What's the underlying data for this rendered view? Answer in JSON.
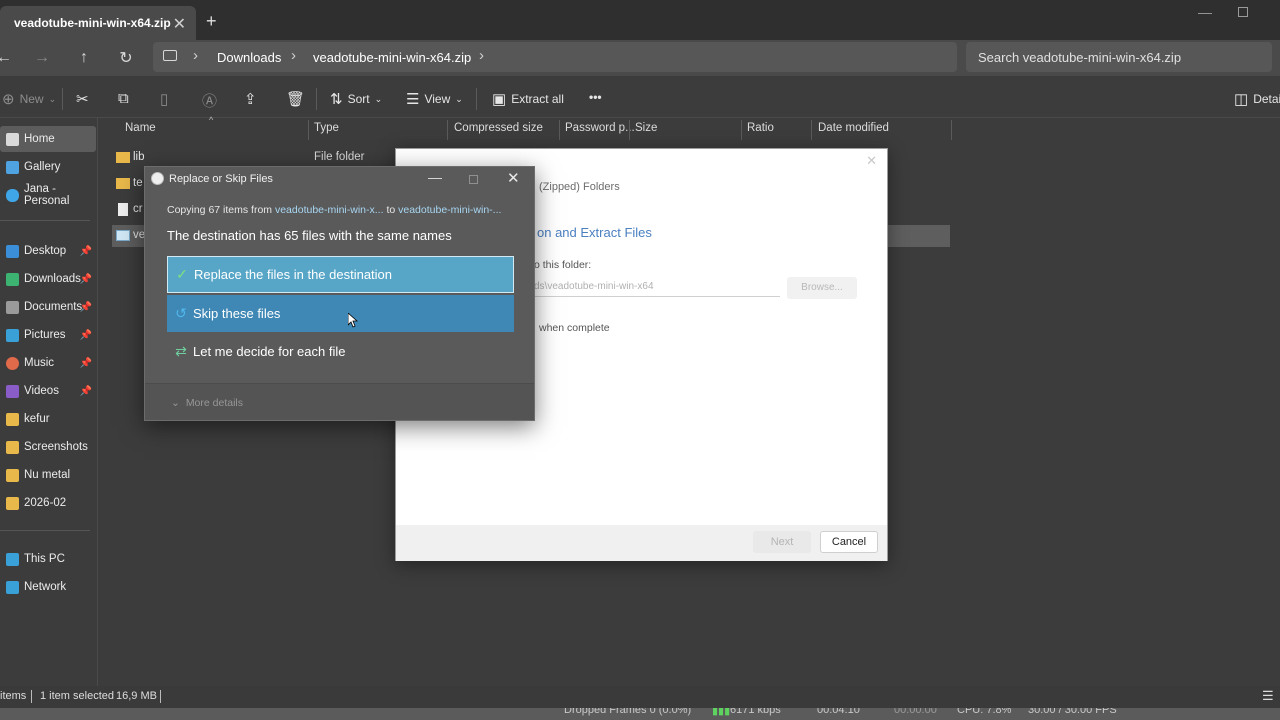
{
  "tab": {
    "title": "veadotube-mini-win-x64.zip",
    "close": "✕",
    "new": "+"
  },
  "window": {
    "minimize": "—"
  },
  "nav": {
    "back": "←",
    "forward": "→",
    "up": "↑",
    "refresh": "↻"
  },
  "breadcrumb": {
    "items": [
      "Downloads",
      "veadotube-mini-win-x64.zip"
    ],
    "sep": "›"
  },
  "search": {
    "placeholder": "Search veadotube-mini-win-x64.zip"
  },
  "commands": {
    "new": "New",
    "sort": "Sort",
    "view": "View",
    "extract_all": "Extract all",
    "more": "•••",
    "details": "Detai"
  },
  "sidebar": {
    "items": [
      {
        "label": "Home",
        "icon": "home-icon",
        "color": "#d9d9d9"
      },
      {
        "label": "Gallery",
        "icon": "gallery-icon",
        "color": "#4fa3e0"
      },
      {
        "label": "Jana - Personal",
        "icon": "cloud-icon",
        "color": "#3fa6e8"
      },
      {
        "label": "Desktop",
        "icon": "desktop-icon",
        "color": "#3b8fd8"
      },
      {
        "label": "Downloads",
        "icon": "download-icon",
        "color": "#3cb371"
      },
      {
        "label": "Documents",
        "icon": "documents-icon",
        "color": "#9a9a9a"
      },
      {
        "label": "Pictures",
        "icon": "pictures-icon",
        "color": "#3aa0d8"
      },
      {
        "label": "Music",
        "icon": "music-icon",
        "color": "#e06a4a"
      },
      {
        "label": "Videos",
        "icon": "videos-icon",
        "color": "#8a5cc8"
      },
      {
        "label": "kefur",
        "icon": "folder-icon",
        "color": "#e8b84a"
      },
      {
        "label": "Screenshots",
        "icon": "folder-icon",
        "color": "#e8b84a"
      },
      {
        "label": "Nu metal",
        "icon": "folder-icon",
        "color": "#e8b84a"
      },
      {
        "label": "2026-02",
        "icon": "folder-icon",
        "color": "#e8b84a"
      },
      {
        "label": "This PC",
        "icon": "pc-icon",
        "color": "#3aa0d8"
      },
      {
        "label": "Network",
        "icon": "network-icon",
        "color": "#3aa0d8"
      }
    ]
  },
  "columns": [
    "Name",
    "Type",
    "Compressed size",
    "Password p...",
    "Size",
    "Ratio",
    "Date modified"
  ],
  "files": [
    {
      "name": "lib",
      "type": "File folder",
      "icon": "folder-icon"
    },
    {
      "name": "te",
      "type": "",
      "icon": "folder-icon"
    },
    {
      "name": "cr",
      "type": "",
      "icon": "file-icon"
    },
    {
      "name": "ve",
      "type": "",
      "icon": "app-icon"
    }
  ],
  "status": {
    "items": "items",
    "selected": "1 item selected",
    "size": "16,9 MB"
  },
  "taskbar": {
    "dropped": "Dropped Frames 0 (0.0%)",
    "kbps": "6171 kbps",
    "time1": "00:04:10",
    "time2": "00:00:00",
    "cpu": "CPU: 7.8%",
    "fps": "30.00 / 30.00 FPS"
  },
  "wizard": {
    "subtitle": "(Zipped) Folders",
    "heading": "on and Extract Files",
    "label": "o this folder:",
    "path": "ds\\veadotube-mini-win-x64",
    "browse": "Browse...",
    "check": "when complete",
    "next": "Next",
    "cancel": "Cancel",
    "close": "✕"
  },
  "dialog": {
    "title": "Replace or Skip Files",
    "copying_prefix": "Copying 67 items from",
    "source": "veadotube-mini-win-x...",
    "to": "to",
    "dest": "veadotube-mini-win-...",
    "heading": "The destination has 65 files with the same names",
    "replace": "Replace the files in the destination",
    "skip": "Skip these files",
    "decide": "Let me decide for each file",
    "more_details": "More details",
    "minimize": "—",
    "close": "✕"
  }
}
